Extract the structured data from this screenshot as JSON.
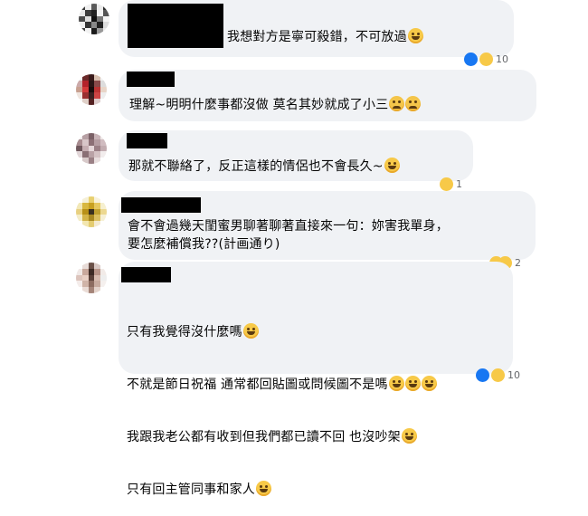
{
  "comments": [
    {
      "lines": [
        "我想對方是寧可殺錯，不可放過"
      ],
      "reaction_count": "10"
    },
    {
      "lines": [
        "理解~明明什麼事都沒做 莫名其妙就成了小三"
      ],
      "reaction_count": ""
    },
    {
      "lines": [
        "那就不聯絡了，反正這樣的情侶也不會長久~"
      ],
      "reaction_count": "1"
    },
    {
      "lines": [
        "會不會過幾天閨蜜男聊著聊著直接來一句：妳害我單身，",
        "要怎麼補償我??(計画通り)"
      ],
      "reaction_count": "2"
    },
    {
      "lines": [
        "只有我覺得沒什麼嗎",
        "不就是節日祝福 通常都回貼圖或問候圖不是嗎",
        "我跟我老公都有收到但我們都已讀不回 也沒吵架",
        "只有回主管同事和家人"
      ],
      "reaction_count": "10"
    }
  ],
  "colors": {
    "bubble": "#f0f2f5",
    "like_blue": "#1877f2",
    "emoji_yellow": "#f7c948"
  }
}
